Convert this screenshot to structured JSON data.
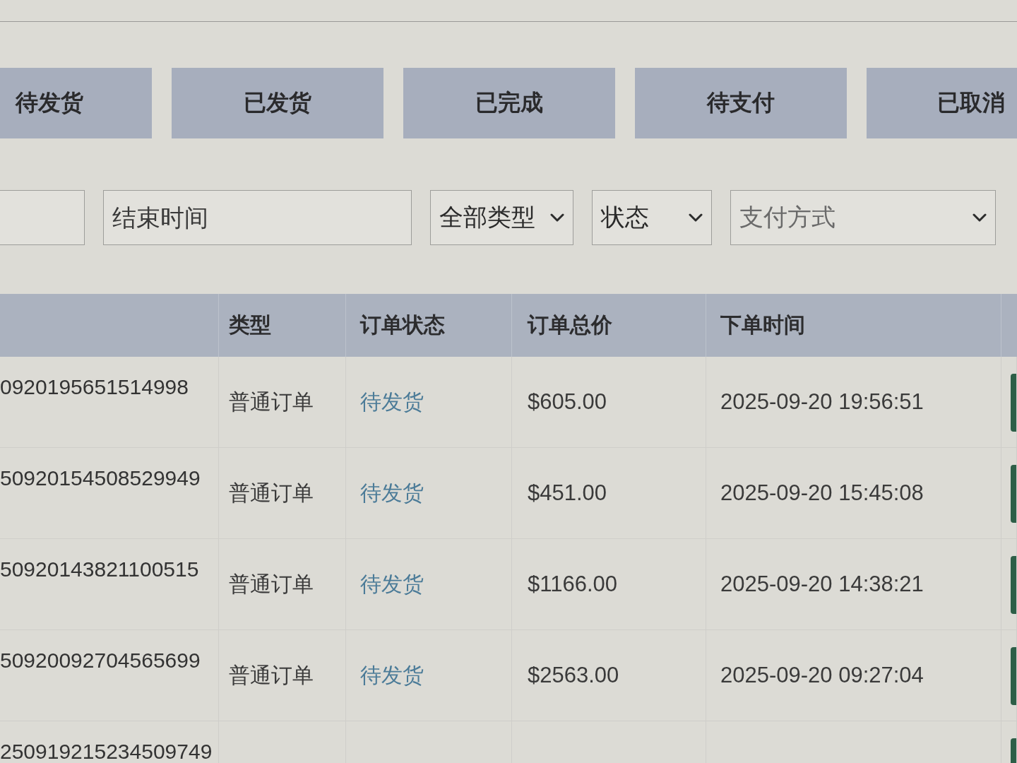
{
  "tabs": [
    {
      "label": "待发货"
    },
    {
      "label": "已发货"
    },
    {
      "label": "已完成"
    },
    {
      "label": "待支付"
    },
    {
      "label": "已取消"
    }
  ],
  "filters": [
    {
      "kind": "input"
    },
    {
      "kind": "input",
      "placeholder": "结束时间"
    },
    {
      "kind": "select",
      "value": "全部类型"
    },
    {
      "kind": "select",
      "value": "状态"
    },
    {
      "kind": "select",
      "placeholder": "支付方式"
    }
  ],
  "table": {
    "columns": [
      {
        "label": "类型"
      },
      {
        "label": "订单状态"
      },
      {
        "label": "订单总价"
      },
      {
        "label": "下单时间"
      }
    ],
    "rows": [
      {
        "order_no": "0920195651514998",
        "type": "普通订单",
        "status": "待发货",
        "total": "$605.00",
        "time": "2025-09-20 19:56:51",
        "action": true
      },
      {
        "order_no": "50920154508529949",
        "type": "普通订单",
        "status": "待发货",
        "total": "$451.00",
        "time": "2025-09-20 15:45:08",
        "action": true
      },
      {
        "order_no": "50920143821100515",
        "type": "普通订单",
        "status": "待发货",
        "total": "$1166.00",
        "time": "2025-09-20 14:38:21",
        "action": true
      },
      {
        "order_no": "50920092704565699",
        "type": "普通订单",
        "status": "待发货",
        "total": "$2563.00",
        "time": "2025-09-20 09:27:04",
        "action": true
      },
      {
        "order_no": "250919215234509749",
        "action": true
      }
    ]
  }
}
